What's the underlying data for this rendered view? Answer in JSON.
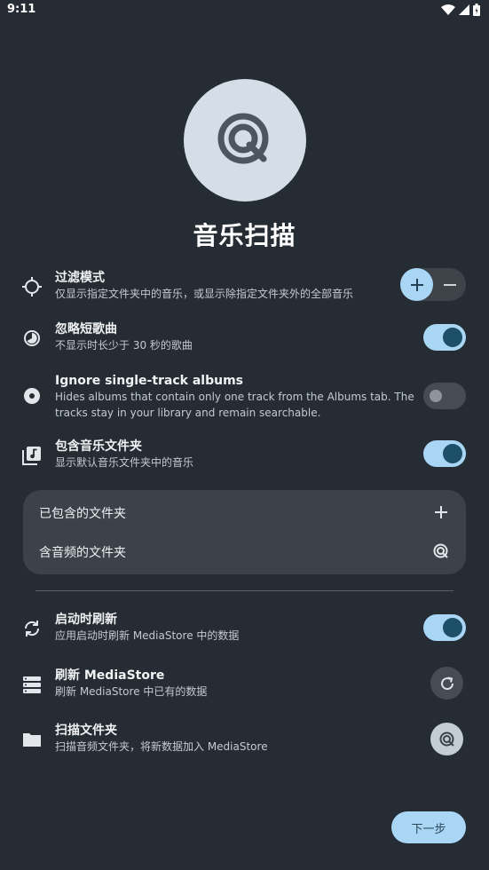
{
  "status": {
    "time": "9:11"
  },
  "page": {
    "title": "音乐扫描"
  },
  "settings": {
    "filter_mode": {
      "title": "过滤模式",
      "subtitle": "仅显示指定文件夹中的音乐，或显示除指定文件夹外的全部音乐"
    },
    "ignore_short": {
      "title": "忽略短歌曲",
      "subtitle": "不显示时长少于 30 秒的歌曲",
      "enabled": true
    },
    "ignore_single": {
      "title": "Ignore single-track albums",
      "subtitle_line1": "Hides albums that contain only one track from the Albums tab. The",
      "subtitle_line2": "tracks stay in your library and remain searchable.",
      "enabled": false
    },
    "include_music_folder": {
      "title": "包含音乐文件夹",
      "subtitle": "显示默认音乐文件夹中的音乐",
      "enabled": true
    }
  },
  "folders": {
    "included_label": "已包含的文件夹",
    "audio_folders_label": "含音频的文件夹"
  },
  "refresh": {
    "on_start": {
      "title": "启动时刷新",
      "subtitle": "应用启动时刷新 MediaStore 中的数据",
      "enabled": true
    },
    "mediastore": {
      "title": "刷新 MediaStore",
      "subtitle": "刷新 MediaStore 中已有的数据"
    },
    "scan_folder": {
      "title": "扫描文件夹",
      "subtitle": "扫描音频文件夹，将新数据加入 MediaStore"
    }
  },
  "footer": {
    "next_label": "下一步"
  },
  "colors": {
    "background": "#252c33",
    "accent": "#a9d6f5",
    "card": "#3b4249"
  }
}
